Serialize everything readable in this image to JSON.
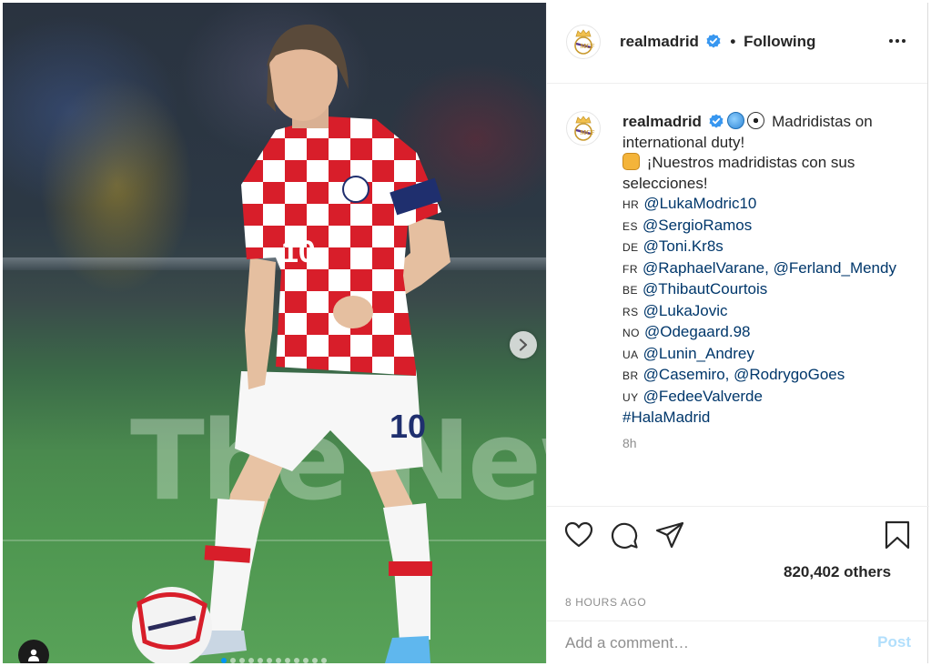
{
  "photo": {
    "board_text": "The New",
    "shirt_number": "10",
    "carousel_dots": 12
  },
  "post": {
    "username": "realmadrid",
    "separator": "•",
    "follow_status": "Following",
    "caption": {
      "headline": "Madridistas on international duty!",
      "subline": "¡Nuestros madridistas con sus selecciones!",
      "mentions": [
        {
          "country": "HR",
          "text": "@LukaModric10"
        },
        {
          "country": "ES",
          "text": "@SergioRamos"
        },
        {
          "country": "DE",
          "text": "@Toni.Kr8s"
        },
        {
          "country": "FR",
          "text": "@RaphaelVarane, @Ferland_Mendy"
        },
        {
          "country": "BE",
          "text": "@ThibautCourtois"
        },
        {
          "country": "RS",
          "text": "@LukaJovic"
        },
        {
          "country": "NO",
          "text": "@Odegaard.98"
        },
        {
          "country": "UA",
          "text": "@Lunin_Andrey"
        },
        {
          "country": "BR",
          "text": "@Casemiro, @RodrygoGoes"
        },
        {
          "country": "UY",
          "text": "@FedeeValverde"
        }
      ],
      "hashtag": "#HalaMadrid"
    },
    "relative_time": "8h",
    "likes": "820,402 others",
    "posted_ago": "8 HOURS AGO"
  },
  "comment": {
    "placeholder": "Add a comment…",
    "post_label": "Post"
  },
  "colors": {
    "verified_blue": "#3897f0",
    "link": "#00376b",
    "muted": "#8e8e8e",
    "post_disabled": "#b2dffc"
  },
  "icons": [
    "more-options-icon",
    "verified-icon",
    "globe-emoji",
    "soccer-ball-emoji",
    "fist-emoji",
    "heart-icon",
    "comment-icon",
    "share-icon",
    "bookmark-icon",
    "chevron-right-icon",
    "user-tag-icon"
  ]
}
